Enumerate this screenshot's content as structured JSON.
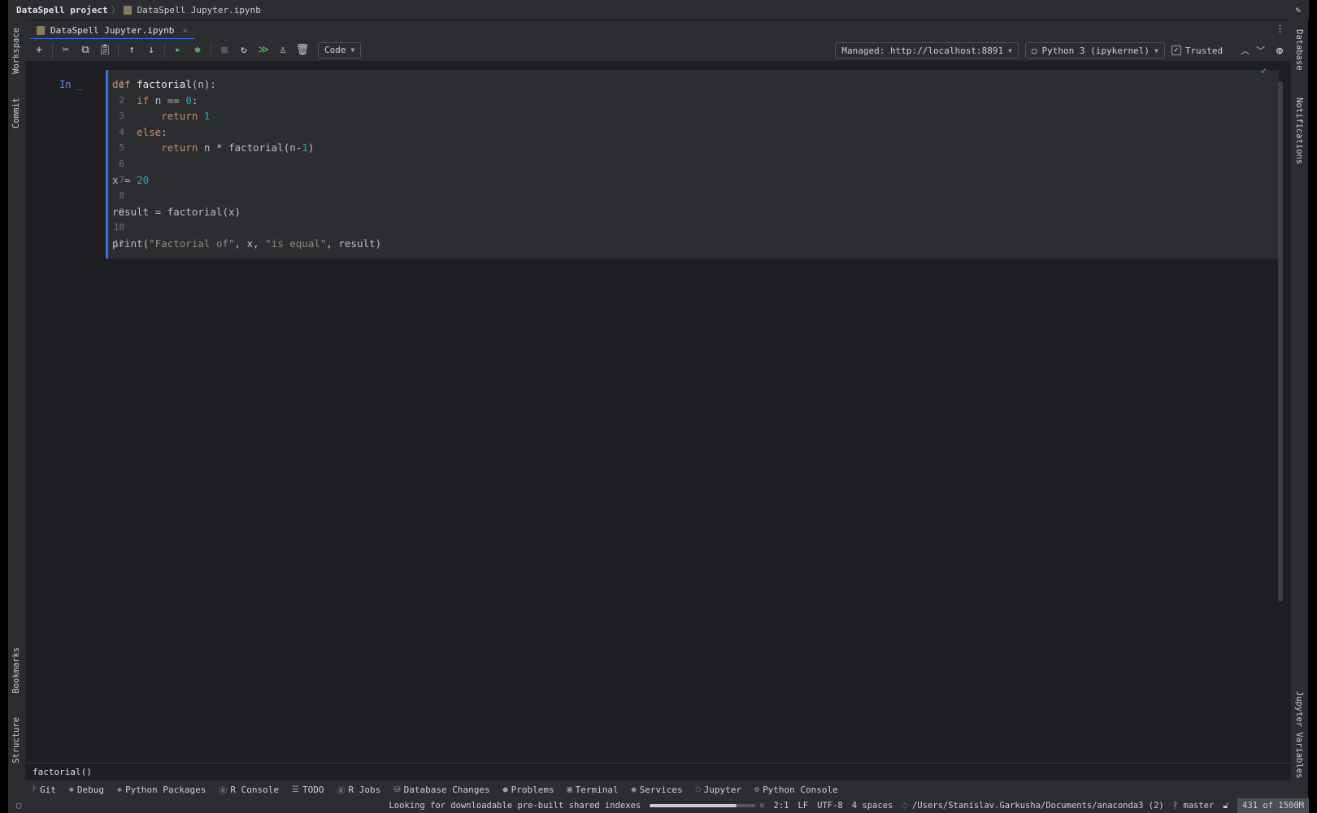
{
  "titlebar": {
    "project": "DataSpell project",
    "file": "DataSpell Jupyter.ipynb"
  },
  "tab": {
    "label": "DataSpell Jupyter.ipynb",
    "close": "×"
  },
  "toolbar": {
    "cell_type": "Code",
    "server": "Managed: http://localhost:8891",
    "kernel": "Python 3 (ipykernel)",
    "trusted": "Trusted"
  },
  "left_strip": [
    "Workspace",
    "Commit",
    "Bookmarks",
    "Structure"
  ],
  "right_strip": [
    "Database",
    "Notifications",
    "Jupyter Variables"
  ],
  "cell": {
    "prompt": "In _",
    "line_numbers": [
      "1",
      "2",
      "3",
      "4",
      "5",
      "6",
      "7",
      "8",
      "9",
      "10",
      "11"
    ],
    "lines": [
      [
        [
          "kw",
          "def "
        ],
        [
          "fn",
          "factorial"
        ],
        [
          "",
          "(n):"
        ]
      ],
      [
        [
          "",
          "    "
        ],
        [
          "kw",
          "if"
        ],
        [
          "",
          " n == "
        ],
        [
          "num",
          "0"
        ],
        [
          "",
          ":"
        ]
      ],
      [
        [
          "",
          "        "
        ],
        [
          "kw",
          "return"
        ],
        [
          "",
          " "
        ],
        [
          "num",
          "1"
        ]
      ],
      [
        [
          "",
          "    "
        ],
        [
          "kw",
          "else"
        ],
        [
          "",
          ":"
        ]
      ],
      [
        [
          "",
          "        "
        ],
        [
          "kw",
          "return"
        ],
        [
          "",
          " n * factorial(n-"
        ],
        [
          "num",
          "1"
        ],
        [
          "",
          ")"
        ]
      ],
      [],
      [
        [
          "",
          "x = "
        ],
        [
          "num",
          "20"
        ]
      ],
      [],
      [
        [
          "",
          "result = factorial(x)"
        ]
      ],
      [],
      [
        [
          "",
          "print("
        ],
        [
          "str",
          "\"Factorial of\""
        ],
        [
          "",
          ", x, "
        ],
        [
          "str",
          "\"is equal\""
        ],
        [
          "",
          ", result)"
        ]
      ]
    ]
  },
  "breadcrumb": "factorial()",
  "tool_windows": [
    {
      "label": "Git",
      "icon": "git-branch-icon"
    },
    {
      "label": "Debug",
      "icon": "bug-icon"
    },
    {
      "label": "Python Packages",
      "icon": "packages-icon"
    },
    {
      "label": "R Console",
      "icon": "r-icon"
    },
    {
      "label": "TODO",
      "icon": "list-icon"
    },
    {
      "label": "R Jobs",
      "icon": "r-icon"
    },
    {
      "label": "Database Changes",
      "icon": "database-icon"
    },
    {
      "label": "Problems",
      "icon": "problems-icon"
    },
    {
      "label": "Terminal",
      "icon": "terminal-icon"
    },
    {
      "label": "Services",
      "icon": "services-icon"
    },
    {
      "label": "Jupyter",
      "icon": "jupyter-icon"
    },
    {
      "label": "Python Console",
      "icon": "python-icon"
    }
  ],
  "status": {
    "task": "Looking for downloadable pre-built shared indexes",
    "progress": 0.82,
    "position": "2:1",
    "line_sep": "LF",
    "encoding": "UTF-8",
    "indent": "4 spaces",
    "interpreter": "/Users/Stanislav.Garkusha/Documents/anaconda3 (2)",
    "branch": "master",
    "memory": "431 of 1500M"
  }
}
